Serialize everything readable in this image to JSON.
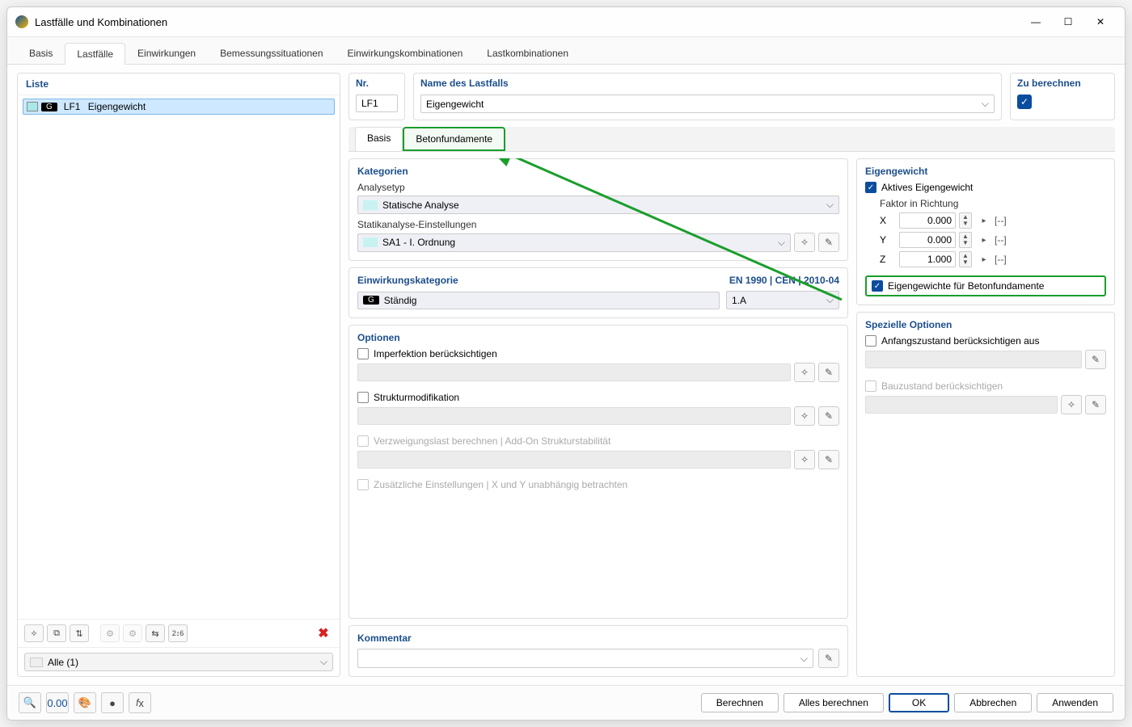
{
  "window": {
    "title": "Lastfälle und Kombinationen"
  },
  "mainTabs": {
    "basis": "Basis",
    "lastfaelle": "Lastfälle",
    "einwirkungen": "Einwirkungen",
    "bemessung": "Bemessungssituationen",
    "einwk": "Einwirkungskombinationen",
    "lastk": "Lastkombinationen"
  },
  "left": {
    "list_label": "Liste",
    "row": {
      "g": "G",
      "id": "LF1",
      "name": "Eigengewicht"
    },
    "filter": "Alle (1)"
  },
  "topStrip": {
    "nr_label": "Nr.",
    "nr_value": "LF1",
    "name_label": "Name des Lastfalls",
    "name_value": "Eigengewicht",
    "calc_label": "Zu berechnen"
  },
  "subTabs": {
    "basis": "Basis",
    "beton": "Betonfundamente"
  },
  "kategorien": {
    "title": "Kategorien",
    "analysistyp_label": "Analysetyp",
    "analysistyp_value": "Statische Analyse",
    "statik_label": "Statikanalyse-Einstellungen",
    "statik_value": "SA1 - I. Ordnung"
  },
  "einwirkung": {
    "title": "Einwirkungskategorie",
    "norm": "EN 1990 | CEN | 2010-04",
    "g": "G",
    "cat_value": "Ständig",
    "sub_value": "1.A"
  },
  "optionen": {
    "title": "Optionen",
    "imperfektion": "Imperfektion berücksichtigen",
    "struktur": "Strukturmodifikation",
    "verzweigung": "Verzweigungslast berechnen | Add-On Strukturstabilität",
    "zusatz": "Zusätzliche Einstellungen | X und Y unabhängig betrachten"
  },
  "eigengewicht": {
    "title": "Eigengewicht",
    "aktiv": "Aktives Eigengewicht",
    "faktor_label": "Faktor in Richtung",
    "x": "X",
    "xv": "0.000",
    "y": "Y",
    "yv": "0.000",
    "z": "Z",
    "zv": "1.000",
    "unit": "[--]",
    "beton_check": "Eigengewichte für Betonfundamente"
  },
  "spezielle": {
    "title": "Spezielle Optionen",
    "anfang": "Anfangszustand berücksichtigen aus",
    "bauzustand": "Bauzustand berücksichtigen"
  },
  "kommentar": {
    "title": "Kommentar"
  },
  "footer": {
    "berechnen": "Berechnen",
    "alles": "Alles berechnen",
    "ok": "OK",
    "abbrechen": "Abbrechen",
    "anwenden": "Anwenden"
  }
}
